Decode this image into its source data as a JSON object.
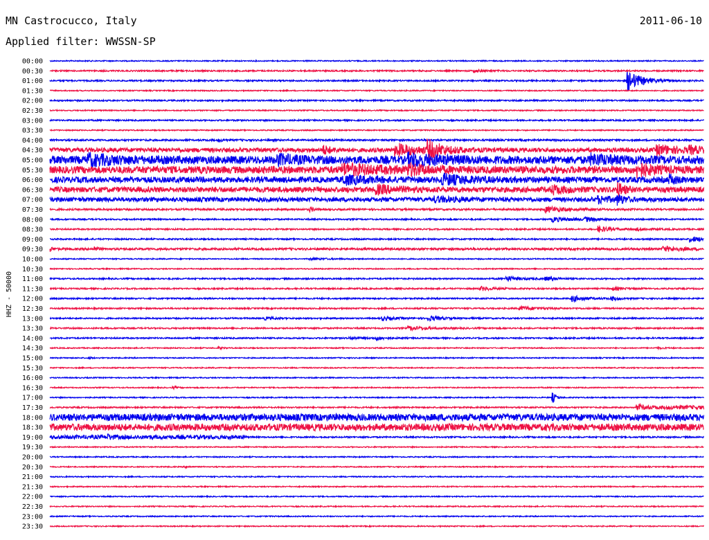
{
  "header": {
    "station": "MN Castrocucco, Italy",
    "date": "2011-06-10",
    "filter": "Applied filter: WWSSN-SP"
  },
  "chart_data": {
    "type": "line",
    "title": "MN Castrocucco, Italy",
    "ylabel": "HHZ - 50000",
    "colors": [
      "#0000ee",
      "#ee1144"
    ],
    "rows": [
      {
        "label": "00:00",
        "level": 0.3,
        "events": []
      },
      {
        "label": "00:30",
        "level": 0.4,
        "events": [
          [
            0.65,
            0.6,
            0.015
          ]
        ]
      },
      {
        "label": "01:00",
        "level": 0.4,
        "events": [
          [
            0.885,
            5.5,
            0.02
          ]
        ]
      },
      {
        "label": "01:30",
        "level": 0.3,
        "events": []
      },
      {
        "label": "02:00",
        "level": 0.4,
        "events": []
      },
      {
        "label": "02:30",
        "level": 0.3,
        "events": []
      },
      {
        "label": "03:00",
        "level": 0.4,
        "events": []
      },
      {
        "label": "03:30",
        "level": 0.3,
        "events": []
      },
      {
        "label": "04:00",
        "level": 0.5,
        "events": [
          [
            0.26,
            0.5,
            0.01
          ]
        ]
      },
      {
        "label": "04:30",
        "level": 1.2,
        "events": [
          [
            0.42,
            2.0,
            0.01
          ],
          [
            0.53,
            3.0,
            0.04
          ],
          [
            0.58,
            4.5,
            0.02
          ],
          [
            0.93,
            2.5,
            0.03
          ],
          [
            0.98,
            1.5,
            0.02
          ]
        ]
      },
      {
        "label": "05:00",
        "level": 2.2,
        "events": [
          [
            0.06,
            2.5,
            0.04
          ],
          [
            0.35,
            2.0,
            0.03
          ],
          [
            0.55,
            2.5,
            0.05
          ],
          [
            0.83,
            2.0,
            0.04
          ]
        ]
      },
      {
        "label": "05:30",
        "level": 2.0,
        "events": [
          [
            0.45,
            2.5,
            0.05
          ],
          [
            0.55,
            2.0,
            0.03
          ],
          [
            0.9,
            3.5,
            0.02
          ]
        ]
      },
      {
        "label": "06:00",
        "level": 1.6,
        "events": [
          [
            0.45,
            2.0,
            0.04
          ],
          [
            0.6,
            2.5,
            0.04
          ],
          [
            0.95,
            2.0,
            0.01
          ]
        ]
      },
      {
        "label": "06:30",
        "level": 1.5,
        "events": [
          [
            0.5,
            2.0,
            0.03
          ],
          [
            0.77,
            2.0,
            0.02
          ],
          [
            0.87,
            3.0,
            0.01
          ]
        ]
      },
      {
        "label": "07:00",
        "level": 1.2,
        "events": [
          [
            0.59,
            1.2,
            0.03
          ],
          [
            0.84,
            1.5,
            0.02
          ],
          [
            0.87,
            2.0,
            0.01
          ]
        ]
      },
      {
        "label": "07:30",
        "level": 0.5,
        "events": [
          [
            0.4,
            1.0,
            0.005
          ],
          [
            0.76,
            1.5,
            0.03
          ]
        ]
      },
      {
        "label": "08:00",
        "level": 0.4,
        "events": [
          [
            0.77,
            1.2,
            0.03
          ],
          [
            0.82,
            1.0,
            0.02
          ]
        ]
      },
      {
        "label": "08:30",
        "level": 0.4,
        "events": [
          [
            0.84,
            1.5,
            0.02
          ],
          [
            0.9,
            0.6,
            0.02
          ]
        ]
      },
      {
        "label": "09:00",
        "level": 0.4,
        "events": [
          [
            0.98,
            1.5,
            0.02
          ]
        ]
      },
      {
        "label": "09:30",
        "level": 0.6,
        "events": [
          [
            0.0,
            1.0,
            0.005
          ],
          [
            0.07,
            1.0,
            0.005
          ],
          [
            0.94,
            1.2,
            0.03
          ]
        ]
      },
      {
        "label": "10:00",
        "level": 0.3,
        "events": [
          [
            0.4,
            0.4,
            0.03
          ]
        ]
      },
      {
        "label": "10:30",
        "level": 0.3,
        "events": []
      },
      {
        "label": "11:00",
        "level": 0.4,
        "events": [
          [
            0.7,
            1.2,
            0.02
          ],
          [
            0.76,
            1.0,
            0.015
          ]
        ]
      },
      {
        "label": "11:30",
        "level": 0.4,
        "events": [
          [
            0.66,
            1.0,
            0.02
          ],
          [
            0.86,
            0.8,
            0.02
          ]
        ]
      },
      {
        "label": "12:00",
        "level": 0.4,
        "events": [
          [
            0.8,
            1.5,
            0.02
          ],
          [
            0.86,
            1.0,
            0.01
          ]
        ]
      },
      {
        "label": "12:30",
        "level": 0.4,
        "events": [
          [
            0.72,
            1.0,
            0.03
          ]
        ]
      },
      {
        "label": "13:00",
        "level": 0.4,
        "events": [
          [
            0.33,
            0.6,
            0.015
          ],
          [
            0.51,
            1.0,
            0.02
          ],
          [
            0.58,
            1.2,
            0.02
          ]
        ]
      },
      {
        "label": "13:30",
        "level": 0.4,
        "events": [
          [
            0.55,
            1.0,
            0.03
          ]
        ]
      },
      {
        "label": "14:00",
        "level": 0.4,
        "events": [
          [
            0.46,
            0.5,
            0.02
          ],
          [
            0.5,
            1.0,
            0.01
          ]
        ]
      },
      {
        "label": "14:30",
        "level": 0.3,
        "events": [
          [
            0.26,
            0.5,
            0.005
          ],
          [
            0.93,
            0.4,
            0.01
          ]
        ]
      },
      {
        "label": "15:00",
        "level": 0.3,
        "events": [
          [
            0.06,
            0.4,
            0.005
          ]
        ]
      },
      {
        "label": "15:30",
        "level": 0.3,
        "events": []
      },
      {
        "label": "16:00",
        "level": 0.3,
        "events": []
      },
      {
        "label": "16:30",
        "level": 0.3,
        "events": [
          [
            0.19,
            0.5,
            0.005
          ]
        ]
      },
      {
        "label": "17:00",
        "level": 0.3,
        "events": [
          [
            0.77,
            2.5,
            0.005
          ]
        ]
      },
      {
        "label": "17:30",
        "level": 0.4,
        "events": [
          [
            0.9,
            1.2,
            0.005
          ]
        ],
        "from": 0.9,
        "fromLevel": 1.1
      },
      {
        "label": "18:00",
        "level": 1.9,
        "events": []
      },
      {
        "label": "18:30",
        "level": 1.9,
        "events": []
      },
      {
        "label": "19:00",
        "level": 0.4,
        "events": [
          [
            0.09,
            1.0,
            0.005
          ],
          [
            0.15,
            0.6,
            0.005
          ]
        ],
        "until": 0.3,
        "untilLevel": 1.1
      },
      {
        "label": "19:30",
        "level": 0.3,
        "events": []
      },
      {
        "label": "20:00",
        "level": 0.3,
        "events": []
      },
      {
        "label": "20:30",
        "level": 0.3,
        "events": [
          [
            0.21,
            0.4,
            0.005
          ]
        ]
      },
      {
        "label": "21:00",
        "level": 0.3,
        "events": []
      },
      {
        "label": "21:30",
        "level": 0.3,
        "events": []
      },
      {
        "label": "22:00",
        "level": 0.3,
        "events": []
      },
      {
        "label": "22:30",
        "level": 0.3,
        "events": []
      },
      {
        "label": "23:00",
        "level": 0.3,
        "events": []
      },
      {
        "label": "23:30",
        "level": 0.3,
        "events": []
      }
    ]
  }
}
